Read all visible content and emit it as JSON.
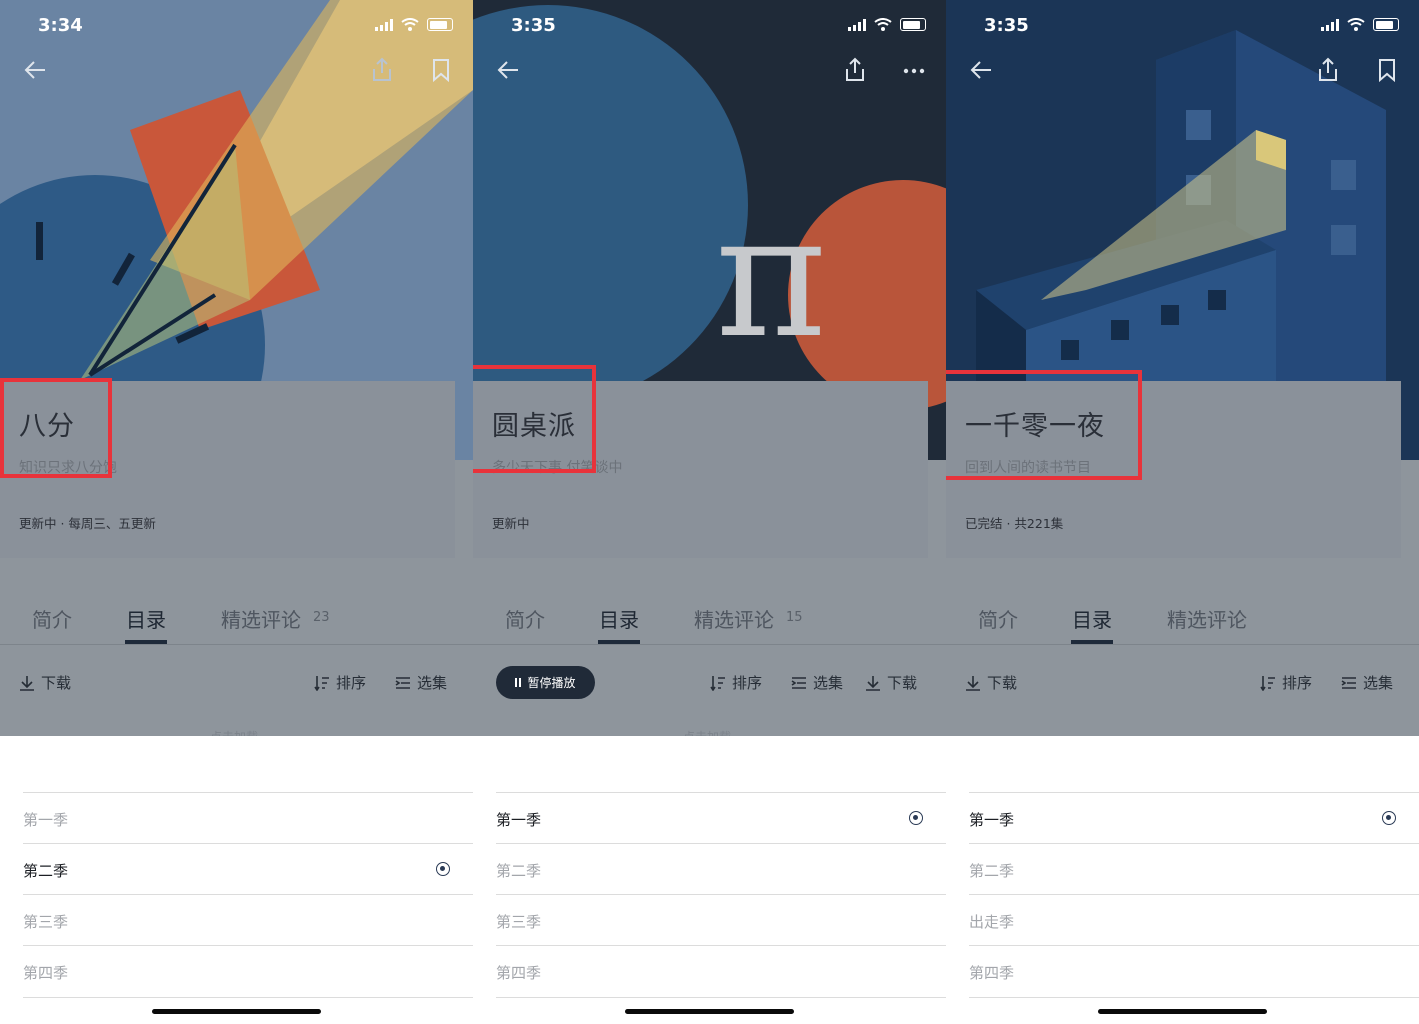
{
  "panels": [
    {
      "status_time": "3:34",
      "title": "八分",
      "subtitle": "知识只求八分饱",
      "status_line": "更新中 · 每周三、五更新",
      "tabs": [
        "简介",
        "目录",
        "精选评论"
      ],
      "comment_count": "23",
      "toolbar": {
        "download": "下载",
        "sort": "排序",
        "select": "选集",
        "pause": ""
      },
      "loading": "点击加载",
      "seasons": [
        "第一季",
        "第二季",
        "第三季",
        "第四季"
      ],
      "selected_season": 1,
      "hero_bg": "#6a84a3",
      "nav_icons": [
        "share-icon",
        "bookmark-icon"
      ]
    },
    {
      "status_time": "3:35",
      "title": "圆桌派",
      "subtitle": "多少天下事 付笑谈中",
      "status_line": "更新中",
      "tabs": [
        "简介",
        "目录",
        "精选评论"
      ],
      "comment_count": "15",
      "toolbar": {
        "download": "下载",
        "sort": "排序",
        "select": "选集",
        "pause": "暂停播放"
      },
      "loading": "点击加载",
      "seasons": [
        "第一季",
        "第二季",
        "第三季",
        "第四季"
      ],
      "selected_season": 0,
      "hero_bg": "#1f2a38",
      "nav_icons": [
        "share-icon",
        "more-icon"
      ]
    },
    {
      "status_time": "3:35",
      "title": "一千零一夜",
      "subtitle": "回到人间的读书节目",
      "status_line": "已完结 · 共221集",
      "tabs": [
        "简介",
        "目录",
        "精选评论"
      ],
      "comment_count": "",
      "toolbar": {
        "download": "下载",
        "sort": "排序",
        "select": "选集",
        "pause": ""
      },
      "loading": "",
      "seasons": [
        "第一季",
        "第二季",
        "出走季",
        "第四季"
      ],
      "selected_season": 0,
      "hero_bg": "#1b3556",
      "nav_icons": [
        "share-icon",
        "bookmark-icon"
      ]
    }
  ],
  "colors": {
    "highlight": "#e8333b",
    "tab_active": "#1e2a3a"
  }
}
